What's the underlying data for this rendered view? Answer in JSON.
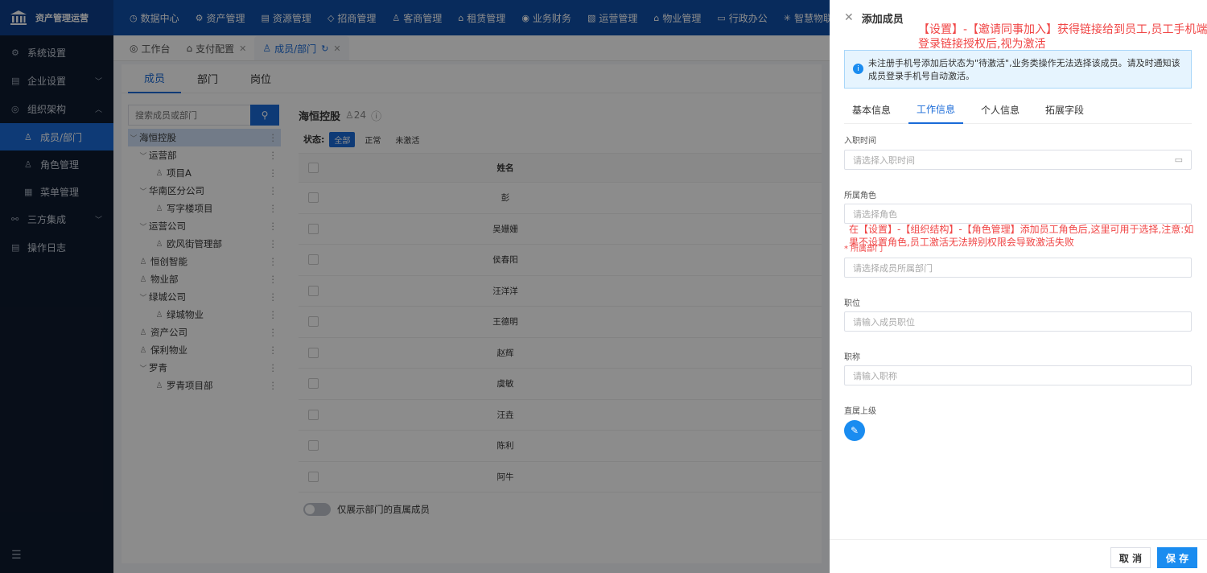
{
  "app": {
    "title": "资产管理运营"
  },
  "topnav": [
    {
      "icon": "◷",
      "label": "数据中心"
    },
    {
      "icon": "⚙",
      "label": "资产管理"
    },
    {
      "icon": "▤",
      "label": "资源管理"
    },
    {
      "icon": "◇",
      "label": "招商管理"
    },
    {
      "icon": "♙",
      "label": "客商管理"
    },
    {
      "icon": "⌂",
      "label": "租赁管理"
    },
    {
      "icon": "◉",
      "label": "业务财务"
    },
    {
      "icon": "▧",
      "label": "运营管理"
    },
    {
      "icon": "⌂",
      "label": "物业管理"
    },
    {
      "icon": "▭",
      "label": "行政办公"
    },
    {
      "icon": "✳",
      "label": "智慧物联"
    }
  ],
  "sidebar": {
    "items": [
      {
        "label": "系统设置",
        "icon": "⚙"
      },
      {
        "label": "企业设置",
        "icon": "▤"
      },
      {
        "label": "组织架构",
        "icon": "◎"
      },
      {
        "label": "成员/部门",
        "icon": "♙"
      },
      {
        "label": "角色管理",
        "icon": "♙"
      },
      {
        "label": "菜单管理",
        "icon": "▦"
      },
      {
        "label": "三方集成",
        "icon": "⚯"
      },
      {
        "label": "操作日志",
        "icon": "▤"
      }
    ],
    "collapse_icon": "☰"
  },
  "page_tabs": [
    {
      "label": "工作台",
      "icon": "◎"
    },
    {
      "label": "支付配置",
      "icon": "⌂"
    },
    {
      "label": "成员/部门",
      "icon": "♙"
    }
  ],
  "subtabs": [
    "成员",
    "部门",
    "岗位"
  ],
  "search": {
    "placeholder": "搜索成员或部门"
  },
  "tree": [
    {
      "label": "海恒控股",
      "level": 0,
      "expand": "﹀"
    },
    {
      "label": "运营部",
      "level": 1,
      "expand": "﹀"
    },
    {
      "label": "项目A",
      "level": 2
    },
    {
      "label": "华南区分公司",
      "level": 1,
      "expand": "﹀"
    },
    {
      "label": "写字楼项目",
      "level": 2
    },
    {
      "label": "运营公司",
      "level": 1,
      "expand": "﹀"
    },
    {
      "label": "欧风街管理部",
      "level": 2
    },
    {
      "label": "恒创智能",
      "level": 1
    },
    {
      "label": "物业部",
      "level": 1
    },
    {
      "label": "绿城公司",
      "level": 1,
      "expand": "﹀"
    },
    {
      "label": "绿城物业",
      "level": 2
    },
    {
      "label": "资产公司",
      "level": 1
    },
    {
      "label": "保利物业",
      "level": 1
    },
    {
      "label": "罗青",
      "level": 1,
      "expand": "﹀"
    },
    {
      "label": "罗青项目部",
      "level": 2
    }
  ],
  "members": {
    "company": "海恒控股",
    "count": "24",
    "status_label": "状态:",
    "status_options": [
      "全部",
      "正常",
      "未激活"
    ],
    "column_name": "姓名",
    "rows": [
      "彭",
      "吴姗姗",
      "侯春阳",
      "汪洋洋",
      "王德明",
      "赵辉",
      "虞敏",
      "汪垚",
      "陈利",
      "阿牛"
    ],
    "toggle_label": "仅展示部门的直属成员"
  },
  "drawer": {
    "title": "添加成员",
    "annotation_top": "【设置】-【邀请同事加入】获得链接给到员工,员工手机端登录链接授权后,视为激活",
    "annotation_role": "在【设置】-【组织结构】-【角色管理】添加员工角色后,这里可用于选择,注意:如果不设置角色,员工激活无法辨别权限会导致激活失败",
    "info": "未注册手机号添加后状态为\"待激活\",业务类操作无法选择该成员。请及时通知该成员登录手机号自动激活。",
    "tabs": [
      "基本信息",
      "工作信息",
      "个人信息",
      "拓展字段"
    ],
    "fields": [
      {
        "label": "入职时间",
        "placeholder": "请选择入职时间"
      },
      {
        "label": "所属角色",
        "placeholder": "请选择角色"
      },
      {
        "label": "* 所属部门",
        "placeholder": "请选择成员所属部门"
      },
      {
        "label": "职位",
        "placeholder": "请输入成员职位"
      },
      {
        "label": "职称",
        "placeholder": "请输入职称"
      }
    ],
    "supervisor_label": "直属上级",
    "cancel": "取 消",
    "save": "保 存"
  }
}
